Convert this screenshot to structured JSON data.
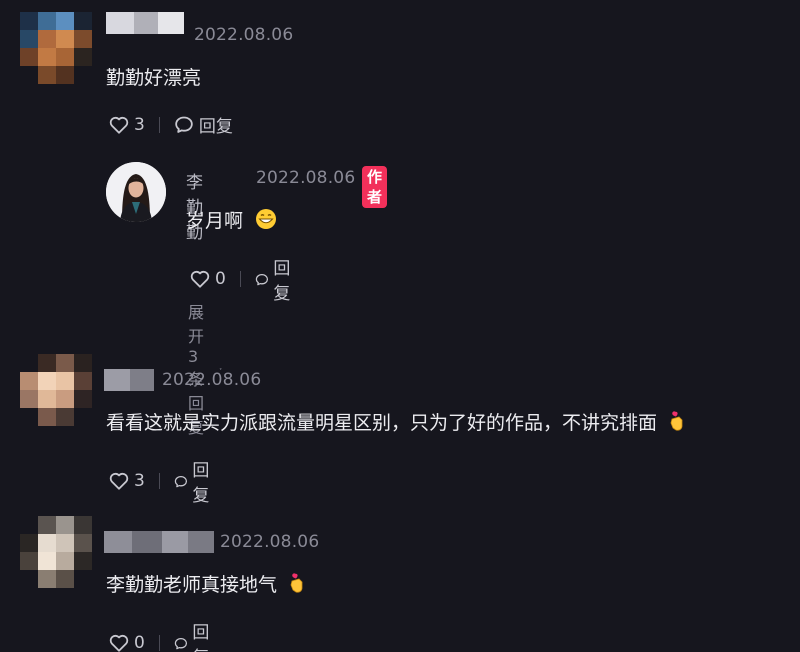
{
  "comments": [
    {
      "timestamp": "2022.08.06",
      "text": "勤勤好漂亮",
      "like_count": "3",
      "reply_label": "回复",
      "reply": {
        "author_name": "李勤勤",
        "timestamp": "2022.08.06",
        "badge": "作者",
        "text": "岁月啊",
        "emoji": "grin-emoji",
        "like_count": "0",
        "reply_label": "回复",
        "expand_label": "展开3条回复"
      }
    },
    {
      "timestamp": "2022.08.06",
      "text": "看看这就是实力派跟流量明星区别，只为了好的作品，不讲究排面",
      "emoji": "finger-heart-emoji",
      "like_count": "3",
      "reply_label": "回复"
    },
    {
      "timestamp": "2022.08.06",
      "text": "李勤勤老师真接地气",
      "emoji": "finger-heart-emoji",
      "like_count": "0",
      "reply_label": "回复"
    }
  ],
  "colors": {
    "background": "#16161e",
    "author_badge": "#f2305a",
    "muted_text": "#8a8a96"
  },
  "icons": [
    "heart-outline-icon",
    "comment-bubble-icon",
    "caret-down-icon"
  ]
}
